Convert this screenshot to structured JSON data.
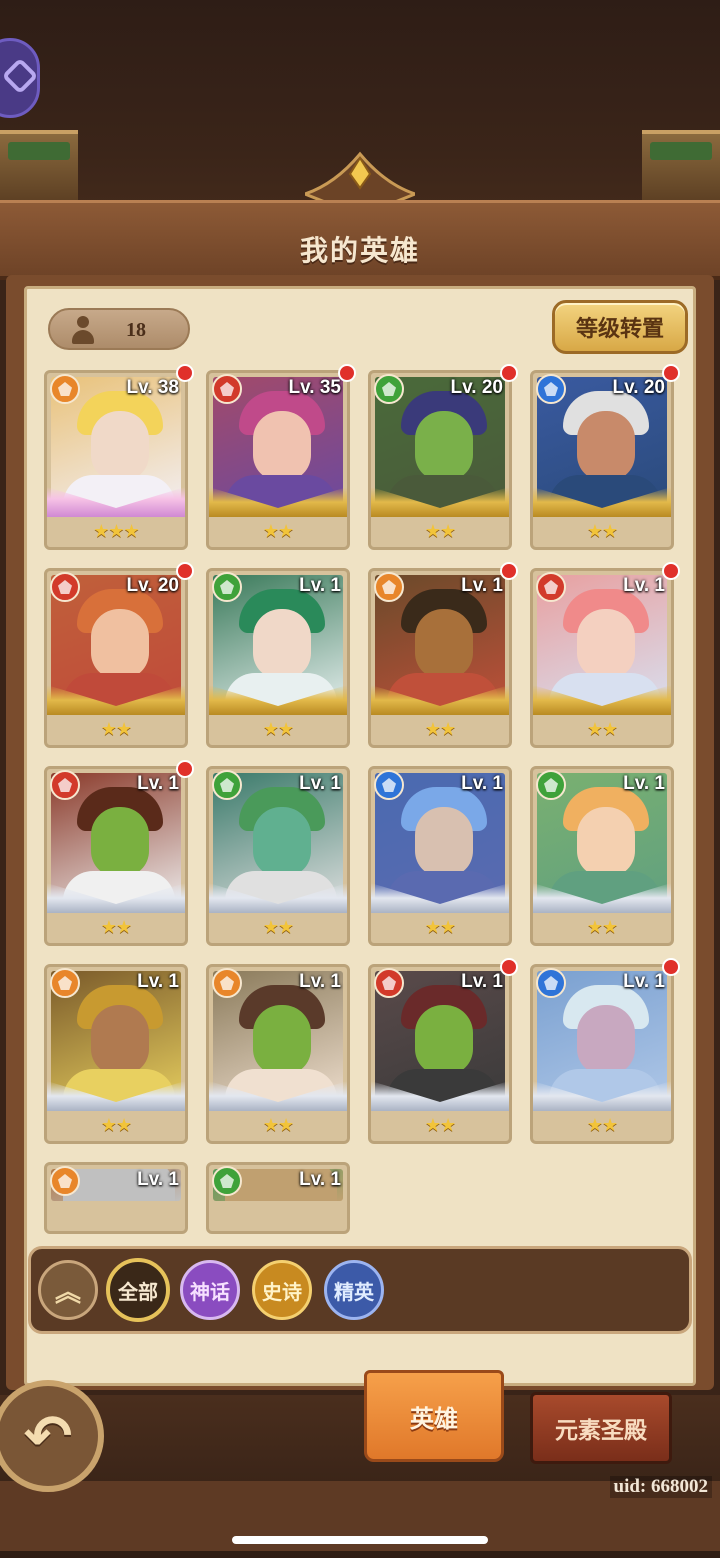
{
  "header": {
    "title": "我的英雄"
  },
  "hero_count": "18",
  "reset_button": "等级转置",
  "heroes": [
    {
      "level": "Lv. 38",
      "stars": "★★★",
      "element": "fire-gold",
      "new": true
    },
    {
      "level": "Lv. 35",
      "stars": "★★",
      "element": "fire-red",
      "new": true
    },
    {
      "level": "Lv. 20",
      "stars": "★★",
      "element": "nature-green",
      "new": true
    },
    {
      "level": "Lv. 20",
      "stars": "★★",
      "element": "water-blue",
      "new": true
    },
    {
      "level": "Lv. 20",
      "stars": "★★",
      "element": "fire-red",
      "new": true
    },
    {
      "level": "Lv. 1",
      "stars": "★★",
      "element": "nature-green",
      "new": false
    },
    {
      "level": "Lv. 1",
      "stars": "★★",
      "element": "fire-gold",
      "new": true
    },
    {
      "level": "Lv. 1",
      "stars": "★★",
      "element": "fire-red",
      "new": true
    },
    {
      "level": "Lv. 1",
      "stars": "★★",
      "element": "fire-red",
      "new": true
    },
    {
      "level": "Lv. 1",
      "stars": "★★",
      "element": "nature-green",
      "new": false
    },
    {
      "level": "Lv. 1",
      "stars": "★★",
      "element": "water-blue",
      "new": false
    },
    {
      "level": "Lv. 1",
      "stars": "★★",
      "element": "nature-green",
      "new": false
    },
    {
      "level": "Lv. 1",
      "stars": "★★",
      "element": "fire-gold",
      "new": false
    },
    {
      "level": "Lv. 1",
      "stars": "★★",
      "element": "fire-gold",
      "new": false
    },
    {
      "level": "Lv. 1",
      "stars": "★★",
      "element": "fire-red",
      "new": true
    },
    {
      "level": "Lv. 1",
      "stars": "★★",
      "element": "water-blue",
      "new": true
    },
    {
      "level": "Lv. 1",
      "stars": "",
      "element": "fire-gold",
      "new": false
    },
    {
      "level": "Lv. 1",
      "stars": "",
      "element": "nature-green",
      "new": false
    }
  ],
  "filters": {
    "collapse": "︽",
    "all": "全部",
    "myth": "神话",
    "epic": "史诗",
    "elite": "精英"
  },
  "tabs": {
    "hero": "英雄",
    "temple": "元素圣殿"
  },
  "back_glyph": "↶",
  "uid": "uid: 668002",
  "colors": {
    "fire-gold": "#e8862a",
    "fire-red": "#d23a2a",
    "nature-green": "#3fa23a",
    "water-blue": "#2f74d8"
  }
}
